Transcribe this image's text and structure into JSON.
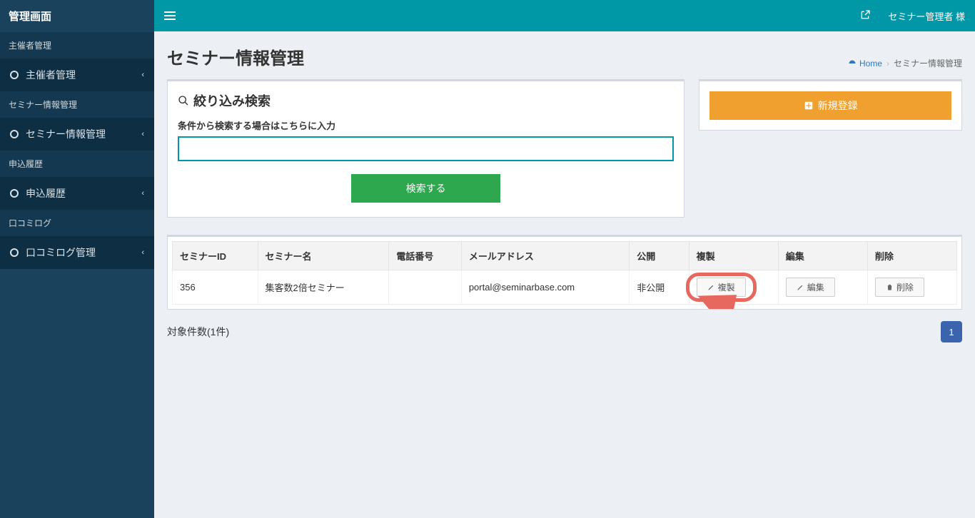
{
  "sidebar": {
    "brand": "管理画面",
    "groups": [
      {
        "header": "主催者管理",
        "item": "主催者管理"
      },
      {
        "header": "セミナー情報管理",
        "item": "セミナー情報管理"
      },
      {
        "header": "申込履歴",
        "item": "申込履歴"
      },
      {
        "header": "口コミログ",
        "item": "口コミログ管理"
      }
    ]
  },
  "topbar": {
    "user": "セミナー管理者 様"
  },
  "page": {
    "title": "セミナー情報管理",
    "breadcrumb_home": "Home",
    "breadcrumb_current": "セミナー情報管理"
  },
  "search": {
    "panel_title": "絞り込み検索",
    "label": "条件から検索する場合はこちらに入力",
    "value": "",
    "button": "検索する"
  },
  "actions": {
    "new_label": "新規登録"
  },
  "table": {
    "headers": [
      "セミナーID",
      "セミナー名",
      "電話番号",
      "メールアドレス",
      "公開",
      "複製",
      "編集",
      "削除"
    ],
    "rows": [
      {
        "id": "356",
        "name": "集客数2倍セミナー",
        "phone": "",
        "email": "portal@seminarbase.com",
        "public": "非公開",
        "copy": "複製",
        "edit": "編集",
        "del": "削除"
      }
    ]
  },
  "footer": {
    "count": "対象件数(1件)",
    "pages": [
      "1"
    ]
  }
}
